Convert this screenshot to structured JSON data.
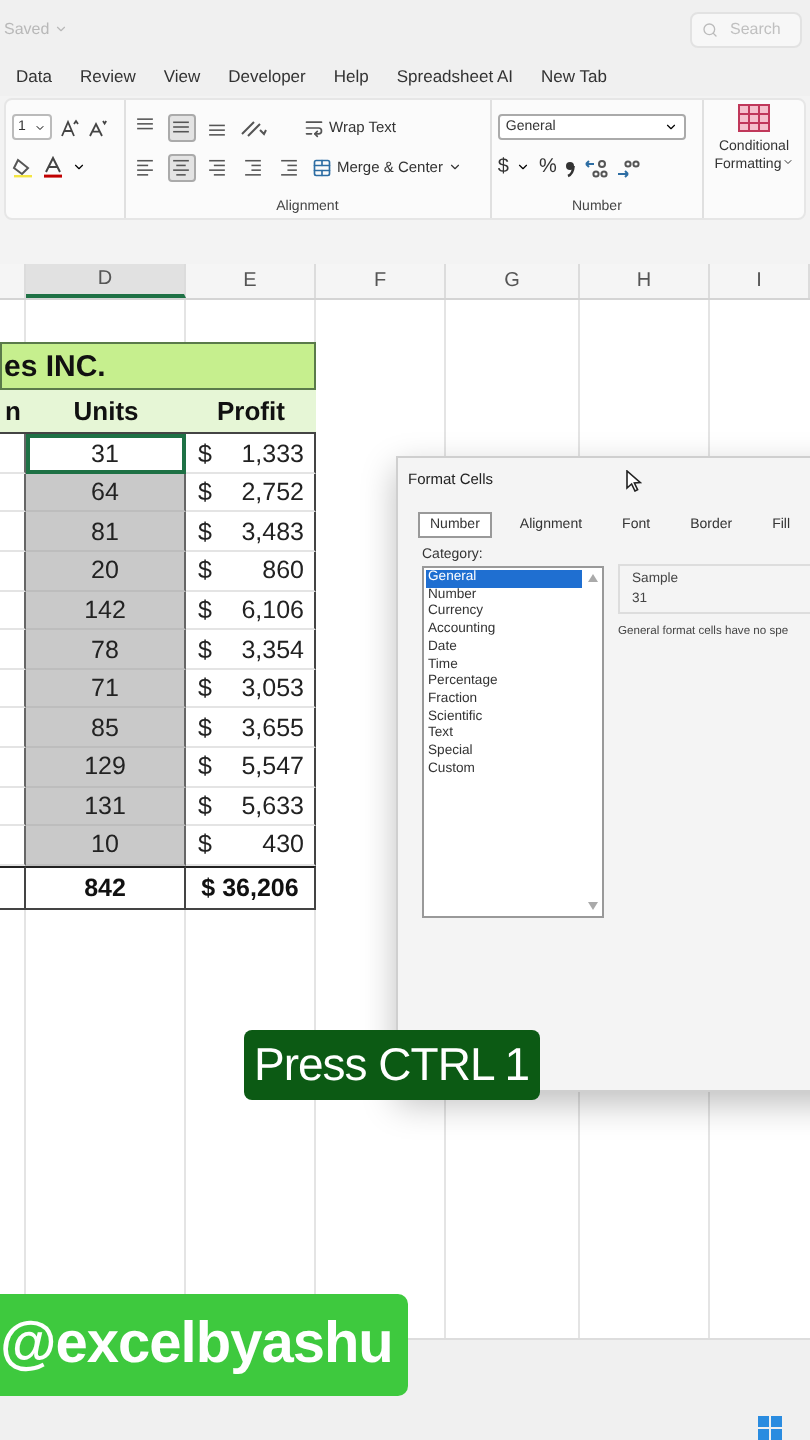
{
  "title_bar": {
    "status": "Saved",
    "search": {
      "placeholder": "Search"
    }
  },
  "menu_tabs": [
    {
      "label": "Data",
      "selected": false
    },
    {
      "label": "Review",
      "selected": false
    },
    {
      "label": "View",
      "selected": false
    },
    {
      "label": "Developer",
      "selected": false
    },
    {
      "label": "Help",
      "selected": false
    },
    {
      "label": "Spreadsheet AI",
      "selected": false
    },
    {
      "label": "New Tab",
      "selected": false
    }
  ],
  "ribbon": {
    "font_size": "1",
    "wrap_text": "Wrap Text",
    "merge_center": "Merge & Center",
    "number_format": "General",
    "currency_symbol": "$",
    "percent_symbol": "%",
    "conditional_formatting": "Conditional Formatting",
    "groups": [
      "Alignment",
      "Number"
    ]
  },
  "columns": [
    "D",
    "E",
    "F",
    "G",
    "H",
    "I"
  ],
  "table": {
    "title": "es INC.",
    "headers": [
      "n",
      "Units",
      "Profit"
    ],
    "rows": [
      {
        "units": "31",
        "currency": "$",
        "profit": "1,333",
        "selected": false,
        "active": true
      },
      {
        "units": "64",
        "currency": "$",
        "profit": "2,752",
        "selected": true,
        "active": false
      },
      {
        "units": "81",
        "currency": "$",
        "profit": "3,483",
        "selected": true,
        "active": false
      },
      {
        "units": "20",
        "currency": "$",
        "profit": "860",
        "selected": true,
        "active": false
      },
      {
        "units": "142",
        "currency": "$",
        "profit": "6,106",
        "selected": true,
        "active": false
      },
      {
        "units": "78",
        "currency": "$",
        "profit": "3,354",
        "selected": true,
        "active": false
      },
      {
        "units": "71",
        "currency": "$",
        "profit": "3,053",
        "selected": true,
        "active": false
      },
      {
        "units": "85",
        "currency": "$",
        "profit": "3,655",
        "selected": true,
        "active": false
      },
      {
        "units": "129",
        "currency": "$",
        "profit": "5,547",
        "selected": true,
        "active": false
      },
      {
        "units": "131",
        "currency": "$",
        "profit": "5,633",
        "selected": true,
        "active": false
      },
      {
        "units": "10",
        "currency": "$",
        "profit": "430",
        "selected": true,
        "active": false
      }
    ],
    "total": {
      "units": "842",
      "profit": "$ 36,206"
    }
  },
  "dialog": {
    "title": "Format Cells",
    "tabs": [
      {
        "label": "Number",
        "selected": true
      },
      {
        "label": "Alignment",
        "selected": false
      },
      {
        "label": "Font",
        "selected": false
      },
      {
        "label": "Border",
        "selected": false
      },
      {
        "label": "Fill",
        "selected": false
      }
    ],
    "category_label": "Category:",
    "categories": [
      {
        "label": "General",
        "selected": true
      },
      {
        "label": "Number",
        "selected": false
      },
      {
        "label": "Currency",
        "selected": false
      },
      {
        "label": "Accounting",
        "selected": false
      },
      {
        "label": "Date",
        "selected": false
      },
      {
        "label": "Time",
        "selected": false
      },
      {
        "label": "Percentage",
        "selected": false
      },
      {
        "label": "Fraction",
        "selected": false
      },
      {
        "label": "Scientific",
        "selected": false
      },
      {
        "label": "Text",
        "selected": false
      },
      {
        "label": "Special",
        "selected": false
      },
      {
        "label": "Custom",
        "selected": false
      }
    ],
    "sample_label": "Sample",
    "sample_value": "31",
    "description": "General format cells have no spe"
  },
  "caption": "Press CTRL 1",
  "handle": "@excelbyashu"
}
